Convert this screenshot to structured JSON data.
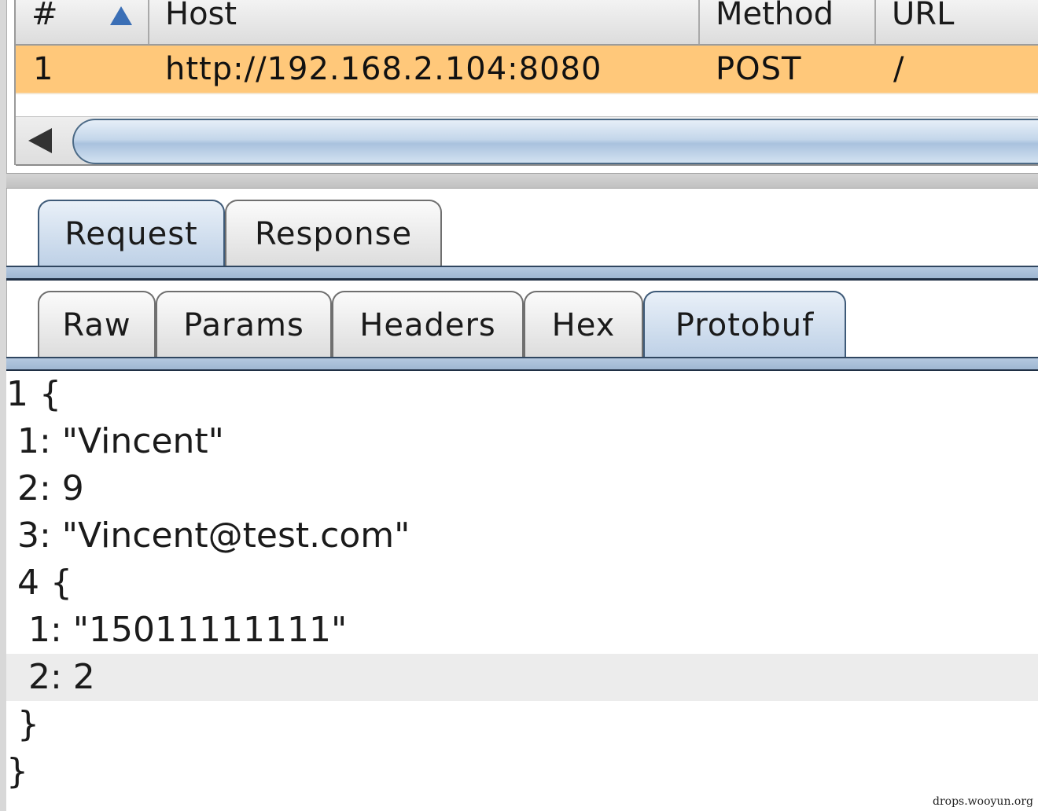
{
  "history_table": {
    "columns": [
      "#",
      "Host",
      "Method",
      "URL"
    ],
    "sort_column": "#",
    "sort_direction": "ascending",
    "rows": [
      {
        "num": "1",
        "host": "http://192.168.2.104:8080",
        "method": "POST",
        "url": "/"
      }
    ],
    "selected_row_color": "#ffc87a"
  },
  "message_tabs": {
    "items": [
      "Request",
      "Response"
    ],
    "active": "Request"
  },
  "view_tabs": {
    "items": [
      "Raw",
      "Params",
      "Headers",
      "Hex",
      "Protobuf"
    ],
    "active": "Protobuf"
  },
  "protobuf_lines": [
    "1 {",
    " 1: \"Vincent\"",
    " 2: 9",
    " 3: \"Vincent@test.com\"",
    " 4 {",
    "  1: \"15011111111\"",
    "  2: 2",
    " }",
    "}"
  ],
  "highlighted_line": 7,
  "watermark": "drops.wooyun.org",
  "colors": {
    "accent": "#3b6fb6",
    "tab_active": "#bdd0e6",
    "tab_line": "#2f4660"
  }
}
